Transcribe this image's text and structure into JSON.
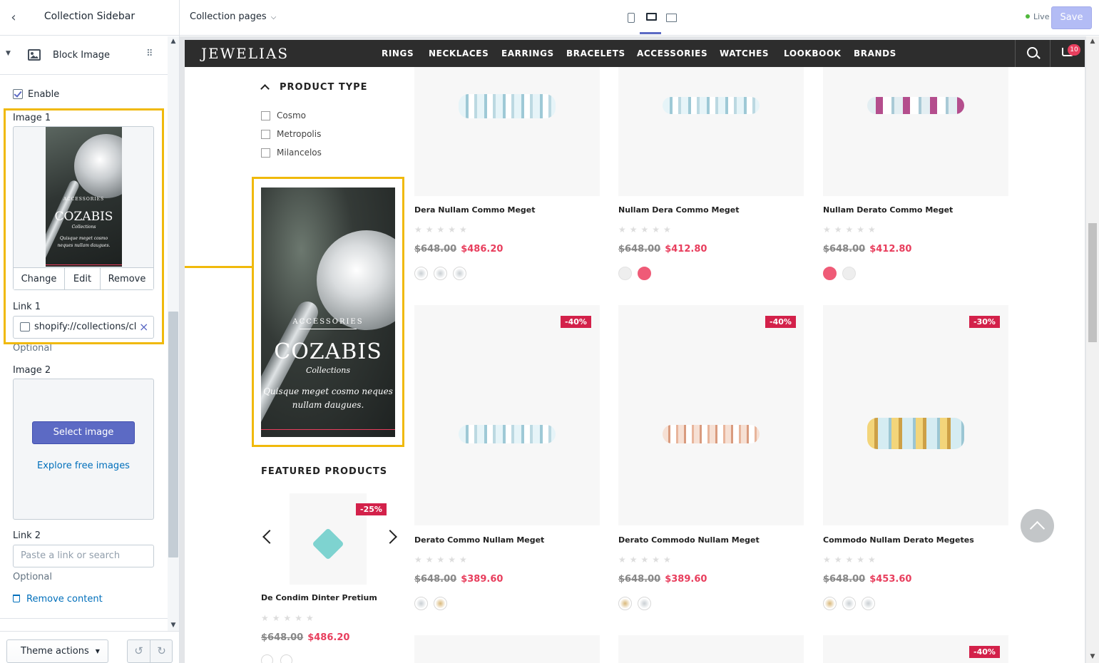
{
  "sidebar": {
    "title": "Collection Sidebar",
    "block": {
      "label": "Block Image"
    },
    "enable_label": "Enable",
    "image1": {
      "label": "Image 1",
      "preview_eyebrow": "ACCESSORIES",
      "preview_title": "COZABIS",
      "preview_sub": "Collections",
      "preview_tagline": "Quisque meget cosmo neques nullam daugues.",
      "change": "Change",
      "edit": "Edit",
      "remove": "Remove"
    },
    "link1": {
      "label": "Link 1",
      "value": "shopify://collections/cl...",
      "help": "Optional"
    },
    "image2": {
      "label": "Image 2",
      "select": "Select image",
      "explore": "Explore free images"
    },
    "link2": {
      "label": "Link 2",
      "placeholder": "Paste a link or search",
      "help": "Optional"
    },
    "remove_content": "Remove content",
    "theme_actions": "Theme actions"
  },
  "topbar": {
    "page_select": "Collection pages",
    "status": "Live",
    "save": "Save"
  },
  "site": {
    "logo": "JEWELIAS",
    "menu": [
      "RINGS",
      "NECKLACES",
      "EARRINGS",
      "BRACELETS",
      "ACCESSORIES",
      "WATCHES",
      "LOOKBOOK",
      "BRANDS"
    ],
    "cart_count": "10",
    "filter": {
      "title": "PRODUCT TYPE",
      "items": [
        "Cosmo",
        "Metropolis",
        "Milancelos"
      ]
    },
    "banner": {
      "eyebrow": "ACCESSORIES",
      "title": "COZABIS",
      "sub": "Collections",
      "tagline_1": "Quisque meget cosmo neques",
      "tagline_2": "nullam daugues."
    },
    "featured": {
      "title": "FEATURED PRODUCTS",
      "badge": "-25%",
      "name": "De Condim Dinter Pretium",
      "old_price": "$648.00",
      "new_price": "$486.20"
    },
    "products": [
      {
        "name": "Dera Nullam Commo Meget",
        "old_price": "$648.00",
        "new_price": "$486.20"
      },
      {
        "name": "Nullam Dera Commo Meget",
        "old_price": "$648.00",
        "new_price": "$412.80"
      },
      {
        "name": "Nullam Derato Commo Meget",
        "old_price": "$648.00",
        "new_price": "$412.80"
      },
      {
        "name": "Derato Commo Nullam Meget",
        "old_price": "$648.00",
        "new_price": "$389.60",
        "badge": "-40%"
      },
      {
        "name": "Derato Commodo Nullam Meget",
        "old_price": "$648.00",
        "new_price": "$389.60",
        "badge": "-40%"
      },
      {
        "name": "Commodo Nullam Derato Megetes",
        "old_price": "$648.00",
        "new_price": "$453.60",
        "badge": "-30%"
      }
    ],
    "row3_badge": "-40%",
    "colors": {
      "accent": "#e83e5d",
      "highlight": "#f0b90b",
      "nav": "#2d2d2d",
      "primary": "#5c6ac4"
    }
  }
}
